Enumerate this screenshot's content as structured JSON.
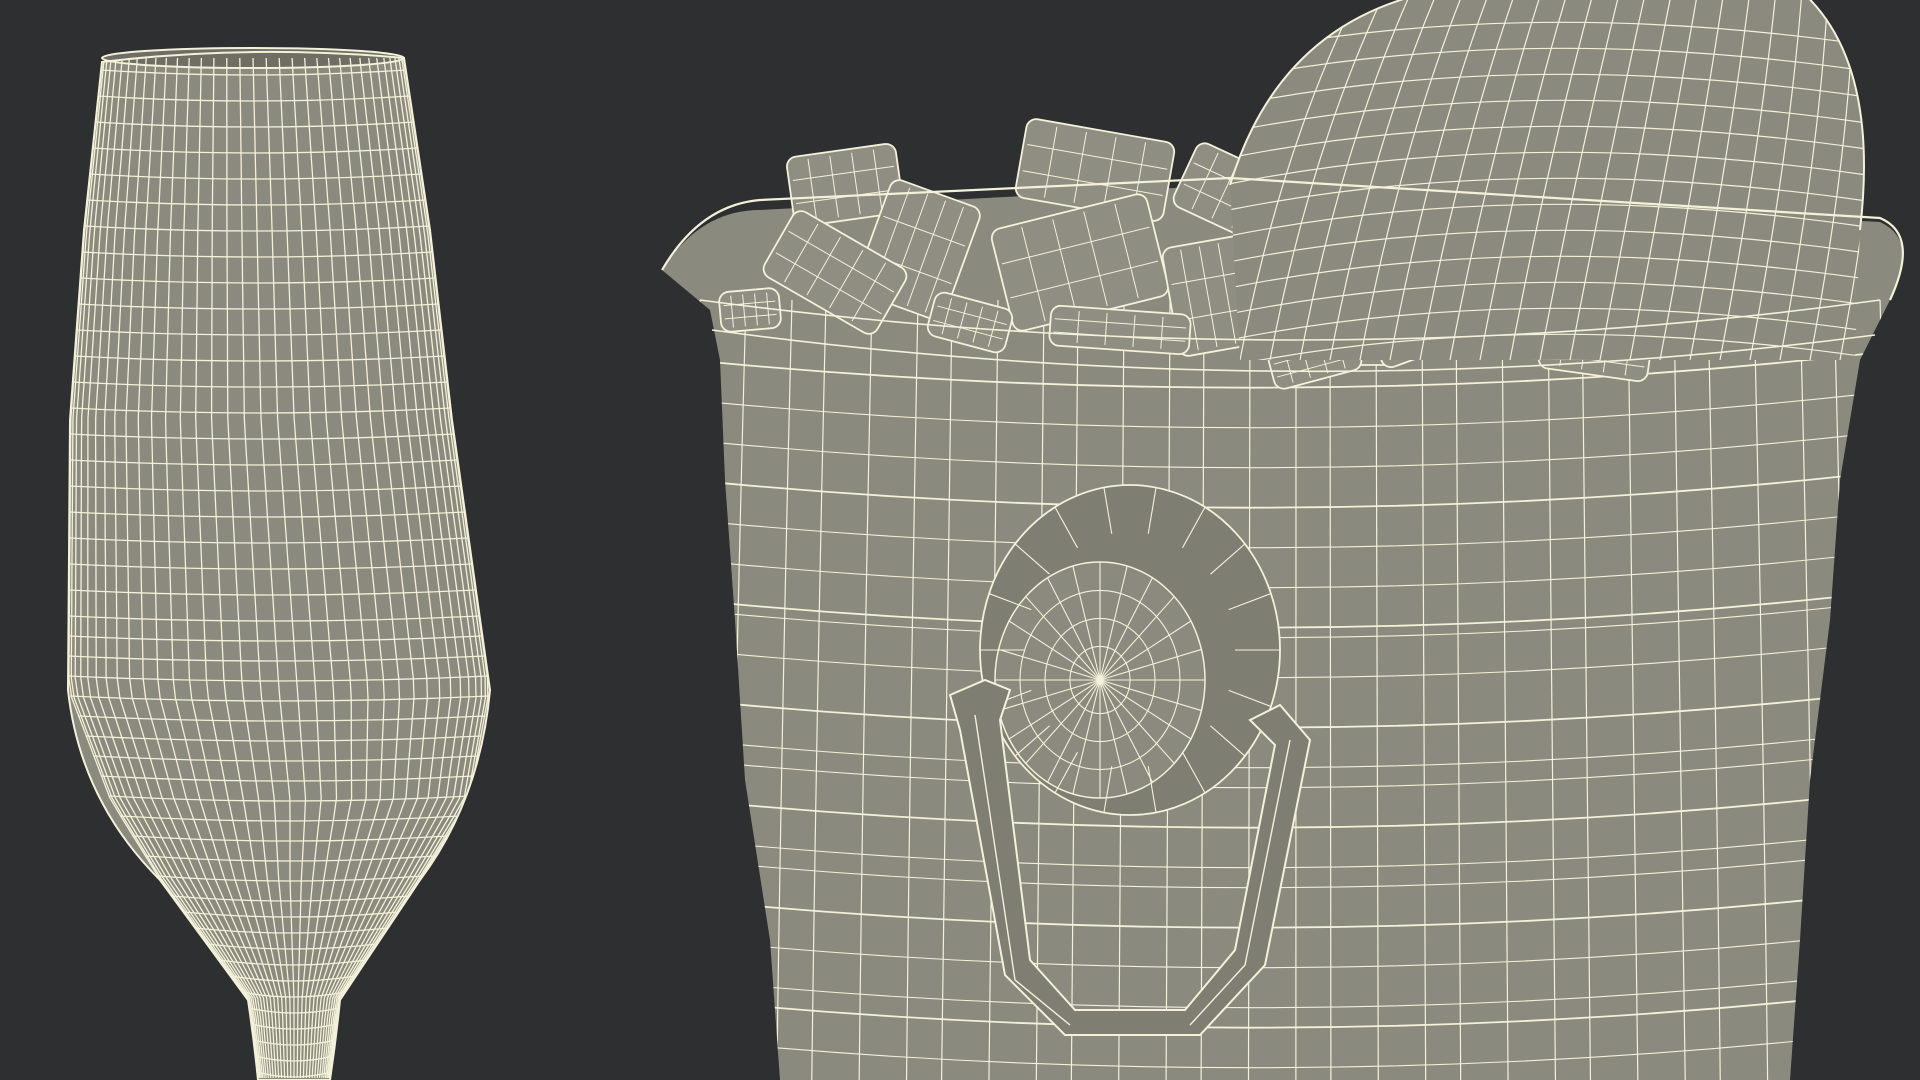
{
  "scene": {
    "description_visible_text": "",
    "colors": {
      "background": "#2e2f30",
      "surface": "#8a8a7e",
      "surface_shadow": "#6e6e64",
      "surface_light": "#9a9a8e",
      "wire": "#f4f1da"
    },
    "objects": [
      {
        "name": "champagne-flute"
      },
      {
        "name": "ice-bucket"
      },
      {
        "name": "champagne-bottle"
      },
      {
        "name": "ice-cubes"
      },
      {
        "name": "lion-head-handle"
      }
    ]
  }
}
